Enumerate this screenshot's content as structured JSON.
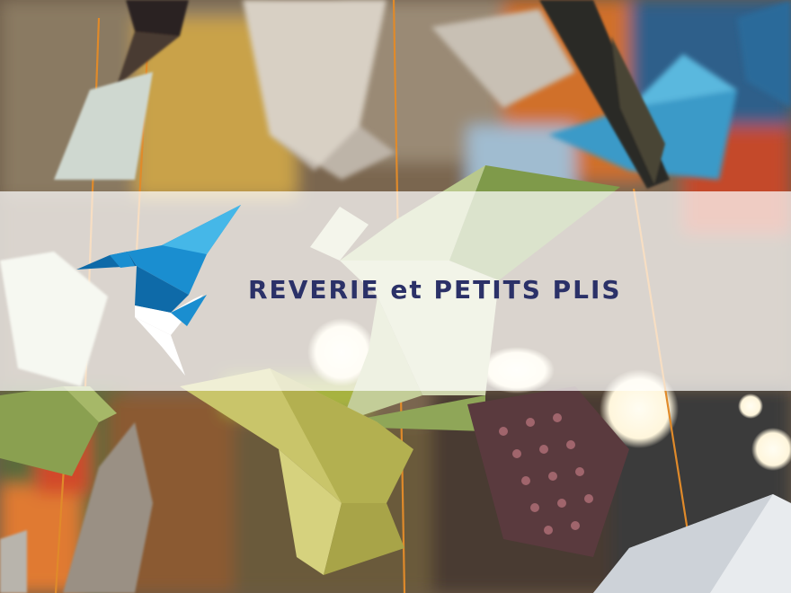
{
  "logo": {
    "text": "REVERIE et PETITS PLIS",
    "text_color": "#2b3168",
    "icon": "origami-hummingbird-icon",
    "icon_colors": [
      "#1a8ed0",
      "#0e6aa8",
      "#45b7e8",
      "#ffffff"
    ]
  },
  "background": {
    "subject": "hanging origami paper birds on strings",
    "overlay_color": "#ffffff"
  }
}
